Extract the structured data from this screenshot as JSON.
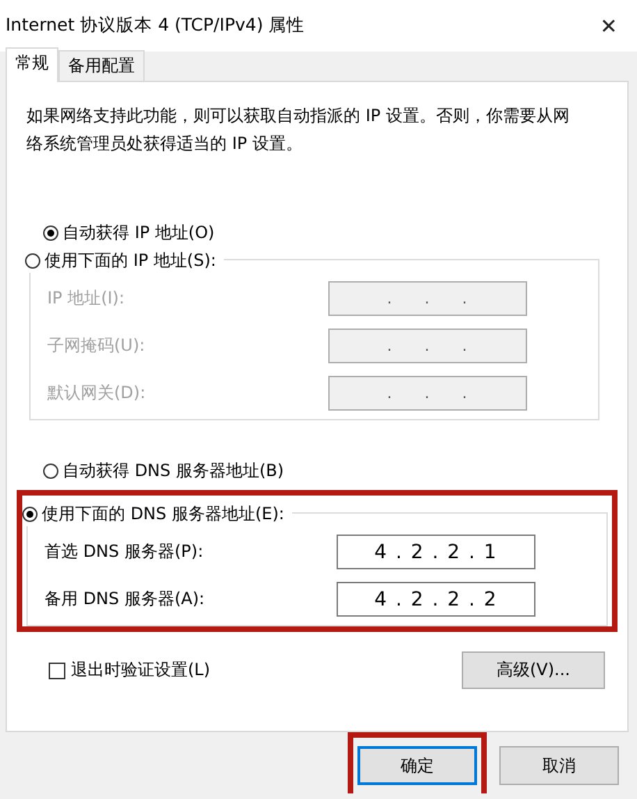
{
  "window": {
    "title": "Internet 协议版本 4 (TCP/IPv4) 属性",
    "close": "✕"
  },
  "tabs": [
    {
      "label": "常规",
      "selected": true
    },
    {
      "label": "备用配置",
      "selected": false
    }
  ],
  "description": "如果网络支持此功能，则可以获取自动指派的 IP 设置。否则，你需要从网络系统管理员处获得适当的 IP 设置。",
  "ip_auto": {
    "label": "自动获得 IP 地址(O)",
    "selected": true
  },
  "ip_manual": {
    "label": "使用下面的 IP 地址(S):",
    "selected": false,
    "disabled": true,
    "highlighted": false,
    "fields": [
      {
        "label": "IP 地址(I):",
        "value": ".     .     ."
      },
      {
        "label": "子网掩码(U):",
        "value": ".     .     ."
      },
      {
        "label": "默认网关(D):",
        "value": ".     .     ."
      }
    ]
  },
  "dns_auto": {
    "label": "自动获得 DNS 服务器地址(B)",
    "selected": false
  },
  "dns_manual": {
    "label": "使用下面的 DNS 服务器地址(E):",
    "selected": true,
    "disabled": false,
    "highlighted": true,
    "fields": [
      {
        "label": "首选 DNS 服务器(P):",
        "value": "4 . 2 . 2 . 1"
      },
      {
        "label": "备用 DNS 服务器(A):",
        "value": "4 . 2 . 2 . 2"
      }
    ]
  },
  "validate": {
    "label": "退出时验证设置(L)",
    "checked": false
  },
  "advanced_button": "高级(V)...",
  "buttons": [
    {
      "label": "确定",
      "highlighted": true,
      "default": true
    },
    {
      "label": "取消",
      "highlighted": false,
      "default": false
    }
  ]
}
